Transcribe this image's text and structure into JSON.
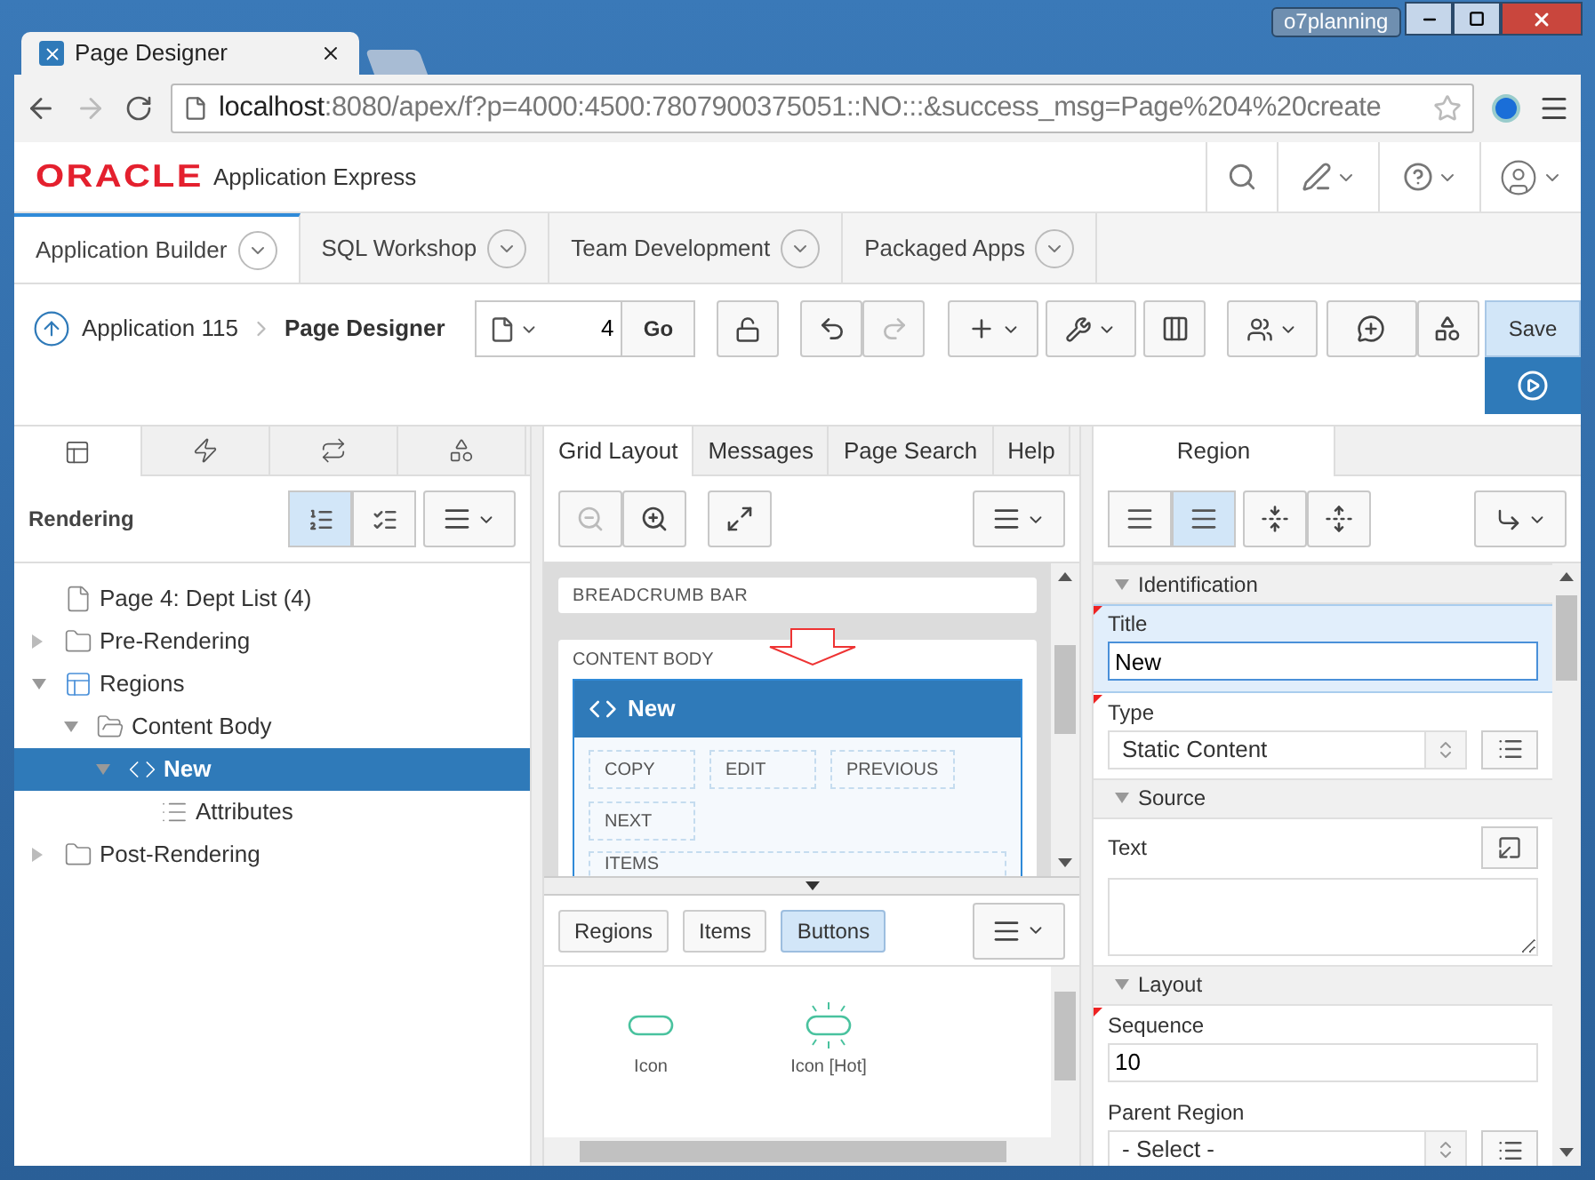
{
  "window": {
    "profile": "o7planning"
  },
  "browser": {
    "tabs": [
      {
        "title": "Page Designer",
        "selected": true
      }
    ],
    "url": {
      "host": "localhost",
      "path": ":8080/apex/f?p=4000:4500:7807900375051::NO:::&success_msg=Page%204%20create"
    }
  },
  "app_header": {
    "logo": "ORACLE",
    "product": "Application Express"
  },
  "nav_tabs": [
    {
      "label": "Application Builder",
      "selected": true
    },
    {
      "label": "SQL Workshop",
      "selected": false
    },
    {
      "label": "Team Development",
      "selected": false
    },
    {
      "label": "Packaged Apps",
      "selected": false
    }
  ],
  "toolbar": {
    "breadcrumb": [
      "Application 115",
      "Page Designer"
    ],
    "page_number": "4",
    "go": "Go",
    "save": "Save"
  },
  "left_panel": {
    "tabs": [
      {
        "selected": true
      },
      {
        "selected": false
      },
      {
        "selected": false
      },
      {
        "selected": false
      }
    ],
    "title": "Rendering",
    "view_toggle": [
      {
        "selected": true
      },
      {
        "selected": false
      }
    ],
    "tree": [
      {
        "label": "Page 4: Dept List (4)",
        "kind": "page",
        "selected": false
      },
      {
        "label": "Pre-Rendering",
        "kind": "folder",
        "expanded": false,
        "selected": false
      },
      {
        "label": "Regions",
        "kind": "region",
        "expanded": true,
        "selected": false,
        "children": [
          {
            "label": "Content Body",
            "kind": "folder-open",
            "expanded": true,
            "selected": false,
            "children": [
              {
                "label": "New",
                "kind": "code",
                "expanded": true,
                "selected": true,
                "children": [
                  {
                    "label": "Attributes",
                    "kind": "list",
                    "selected": false
                  }
                ]
              }
            ]
          }
        ]
      },
      {
        "label": "Post-Rendering",
        "kind": "folder",
        "expanded": false,
        "selected": false
      }
    ]
  },
  "center_panel": {
    "tabs": [
      {
        "label": "Grid Layout",
        "selected": true
      },
      {
        "label": "Messages",
        "selected": false
      },
      {
        "label": "Page Search",
        "selected": false
      },
      {
        "label": "Help",
        "selected": false
      }
    ],
    "canvas": {
      "breadcrumb_bar": "BREADCRUMB BAR",
      "content_body": "CONTENT BODY",
      "region": {
        "title": "New",
        "buttons": [
          "COPY",
          "EDIT",
          "PREVIOUS",
          "NEXT"
        ],
        "items": "ITEMS"
      }
    },
    "gallery": {
      "tabs": [
        {
          "label": "Regions",
          "selected": false
        },
        {
          "label": "Items",
          "selected": false
        },
        {
          "label": "Buttons",
          "selected": true
        }
      ],
      "items": [
        {
          "label": "Icon",
          "hot": false
        },
        {
          "label": "Icon [Hot]",
          "hot": true
        }
      ]
    }
  },
  "right_panel": {
    "tab": {
      "label": "Region",
      "selected": true
    },
    "view_toggle": [
      {
        "selected": false
      },
      {
        "selected": true
      }
    ],
    "sections": [
      {
        "title": "Identification",
        "expanded": true,
        "fields": [
          {
            "label": "Title",
            "kind": "text",
            "value": "New",
            "required": true,
            "selected": true
          },
          {
            "label": "Type",
            "kind": "select",
            "value": "Static Content",
            "required": true,
            "selected": false
          }
        ]
      },
      {
        "title": "Source",
        "expanded": true,
        "fields": [
          {
            "label": "Text",
            "kind": "textarea",
            "required": false,
            "selected": false
          }
        ]
      },
      {
        "title": "Layout",
        "expanded": true,
        "fields": [
          {
            "label": "Sequence",
            "kind": "text",
            "value": "10",
            "required": true,
            "selected": false
          },
          {
            "label": "Parent Region",
            "kind": "select",
            "value": "- Select -",
            "required": false,
            "selected": false
          }
        ]
      }
    ]
  }
}
